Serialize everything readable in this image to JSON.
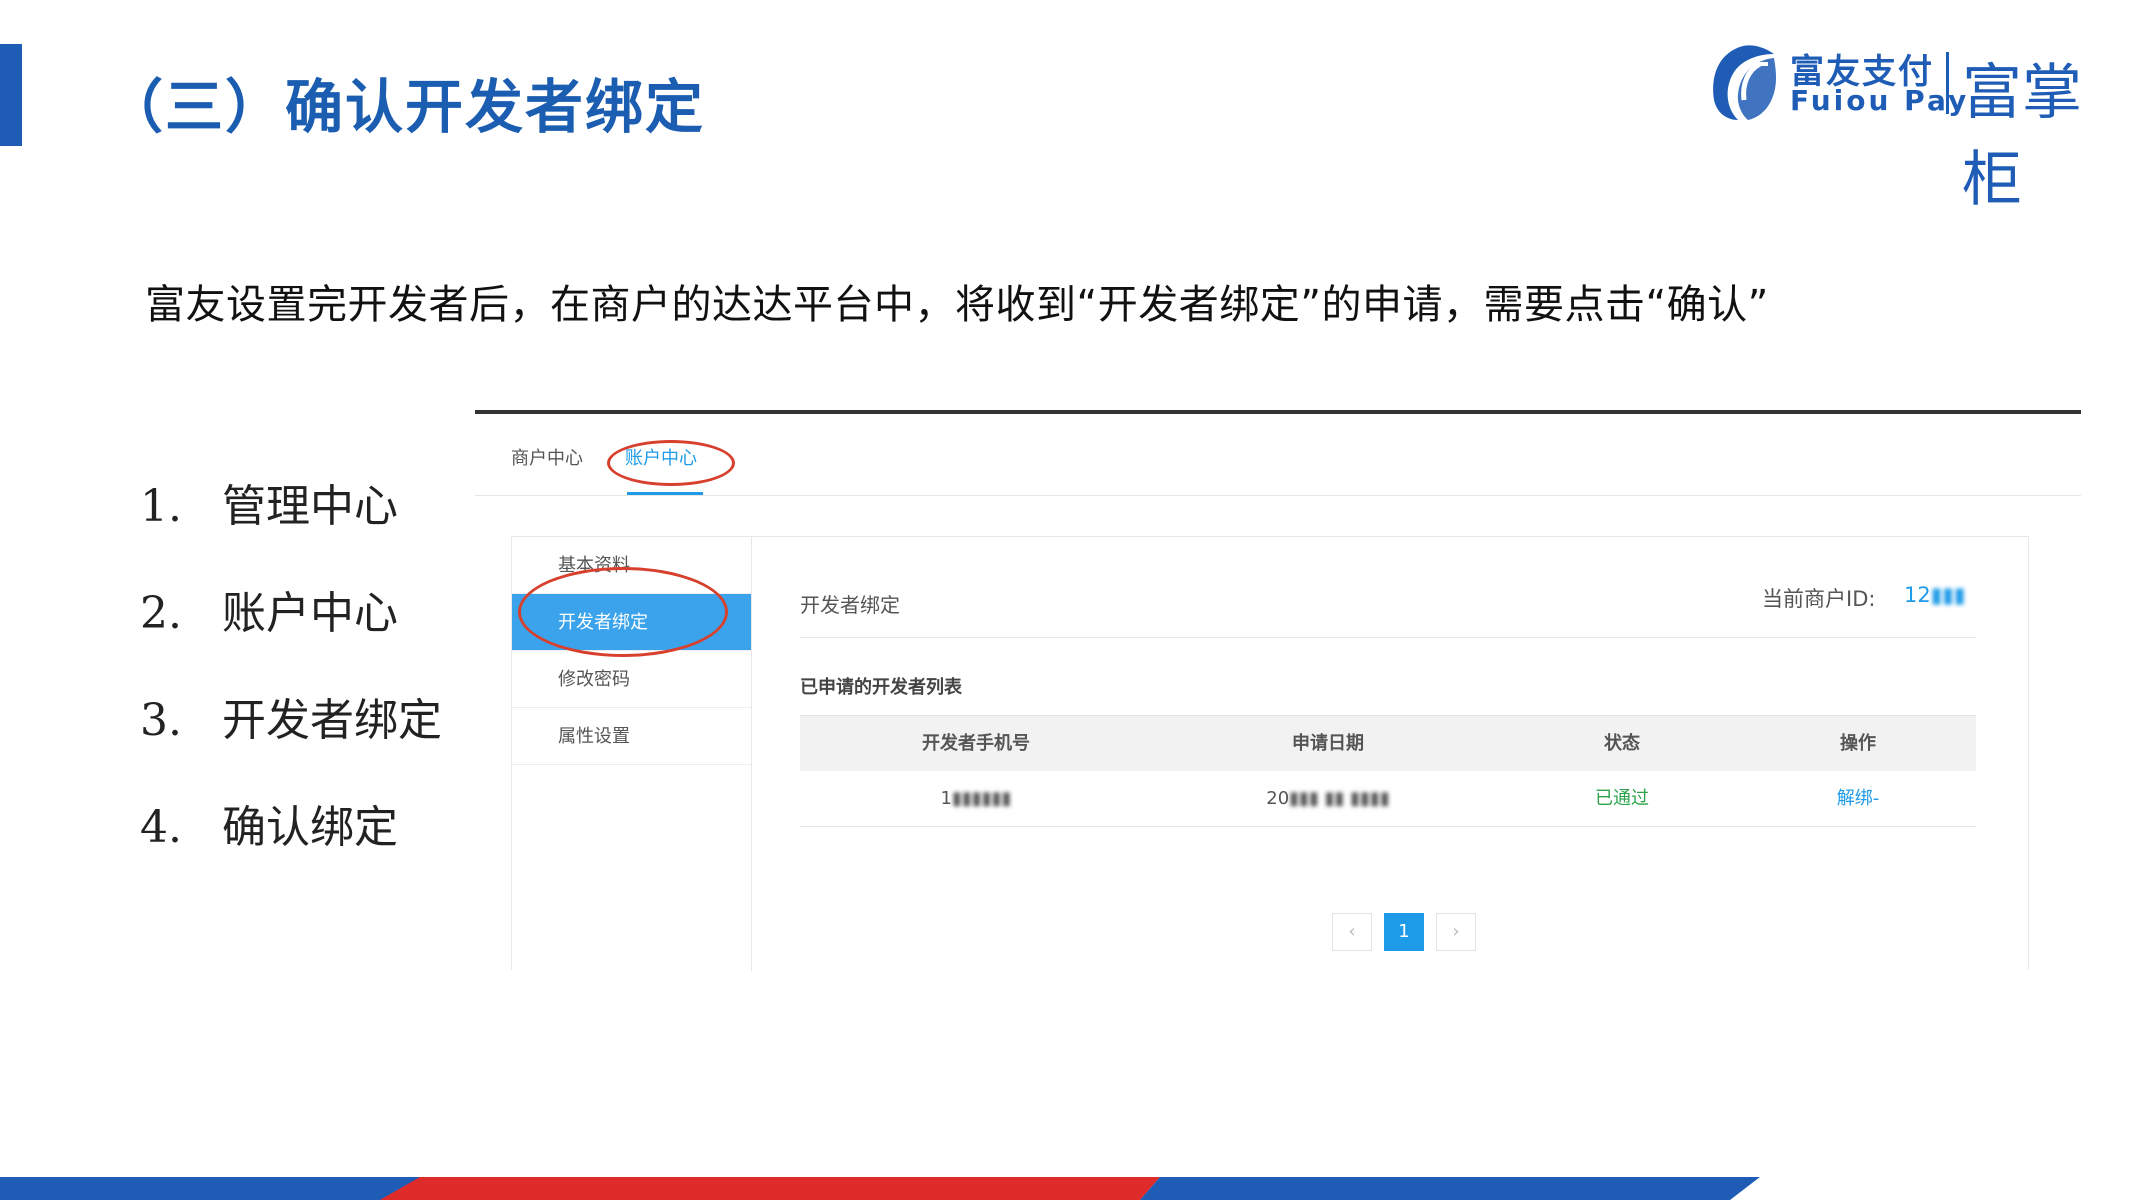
{
  "slide": {
    "title": "（三）确认开发者绑定",
    "intro": "富友设置完开发者后，在商户的达达平台中，将收到“开发者绑定”的申请，需要点击“确认”"
  },
  "logo": {
    "name_cn": "富友支付",
    "name_en": "Fuiou Pay",
    "sub_brand": "富掌柜",
    "color": "#1f5cb5"
  },
  "steps": [
    {
      "num": "1.",
      "label": "管理中心"
    },
    {
      "num": "2.",
      "label": "账户中心"
    },
    {
      "num": "3.",
      "label": "开发者绑定"
    },
    {
      "num": "4.",
      "label": "确认绑定"
    }
  ],
  "screenshot": {
    "topnav": {
      "merchant_center": "商户中心",
      "account_center": "账户中心"
    },
    "sidemenu": [
      {
        "label": "基本资料"
      },
      {
        "label": "开发者绑定"
      },
      {
        "label": "修改密码"
      },
      {
        "label": "属性设置"
      }
    ],
    "content": {
      "title": "开发者绑定",
      "merchant_id_label": "当前商户ID:",
      "merchant_id_value": "12",
      "list_title": "已申请的开发者列表",
      "table": {
        "headers": [
          "开发者手机号",
          "申请日期",
          "状态",
          "操作"
        ],
        "rows": [
          {
            "phone": "1",
            "date": "20",
            "status": "已通过",
            "action": "解绑-"
          }
        ]
      },
      "pager": {
        "prev": "‹",
        "current": "1",
        "next": "›"
      }
    },
    "colors": {
      "accent": "#1e9be8",
      "highlight_circle": "#d8402e",
      "status_ok": "#2aa34a"
    }
  },
  "footer_colors": {
    "blue": "#1f5cb5",
    "red": "#e02b2b"
  }
}
